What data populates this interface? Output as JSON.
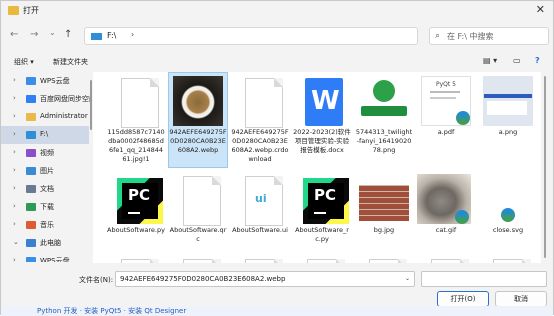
{
  "window": {
    "title": "打开",
    "close_glyph": "✕"
  },
  "nav": {
    "back": "←",
    "forward": "→",
    "up_menu": "⌄",
    "up": "↑",
    "path": "F:\\",
    "path_sep": "›",
    "dropdown": "⌄",
    "refresh": "↻",
    "search_placeholder": "在 F:\\ 中搜索"
  },
  "toolbar": {
    "organize": "组织 ▾",
    "new_folder": "新建文件夹",
    "view": "▤ ▾",
    "pane": "▭",
    "help": "?"
  },
  "sidebar": {
    "items": [
      {
        "label": "WPS云盘",
        "icon": "cloud-icon",
        "color": "#3b8ee8"
      },
      {
        "label": "百度网盘同步空间",
        "icon": "baidu-icon",
        "color": "#2f7ff5"
      },
      {
        "label": "Administrator",
        "icon": "user-folder-icon",
        "color": "#e9b94a"
      },
      {
        "label": "F:\\",
        "icon": "drive-icon",
        "color": "#2f8ed8"
      },
      {
        "label": "视频",
        "icon": "video-icon",
        "color": "#8a4fc9"
      },
      {
        "label": "图片",
        "icon": "pictures-icon",
        "color": "#3a8ad4"
      },
      {
        "label": "文档",
        "icon": "documents-icon",
        "color": "#6a7a90"
      },
      {
        "label": "下载",
        "icon": "download-icon",
        "color": "#2e9a5a"
      },
      {
        "label": "音乐",
        "icon": "music-icon",
        "color": "#e05a32"
      },
      {
        "label": "此电脑",
        "icon": "pc-icon",
        "color": "#3b7fd0"
      },
      {
        "label": "WPS云盘",
        "icon": "cloud-icon",
        "color": "#3b8ee8"
      }
    ],
    "selected_index": 3
  },
  "files": {
    "row1": [
      {
        "name": "115dd8587c7140dba0002f48685d6fe1_qq_21484461.jpg!1",
        "kind": "blank",
        "selected": false
      },
      {
        "name": "942AEFE649275F0D0280CA0B23E608A2.webp",
        "kind": "food",
        "selected": true
      },
      {
        "name": "942AEFE649275F0D0280CA0B23E608A2.webp.crdownload",
        "kind": "blank",
        "selected": false
      },
      {
        "name": "2022-2023(2)软件项目管理实验-实验报告模板.docx",
        "kind": "wps",
        "selected": false
      },
      {
        "name": "5744313_twilight-fanyi_1641902078.png",
        "kind": "techfanyi",
        "selected": false
      },
      {
        "name": "a.pdf",
        "kind": "pdf",
        "selected": false
      },
      {
        "name": "a.png",
        "kind": "apng",
        "selected": false
      }
    ],
    "row2": [
      {
        "name": "AboutSoftware.py",
        "kind": "pycharm",
        "selected": false
      },
      {
        "name": "AboutSoftware.qrc",
        "kind": "blank",
        "selected": false
      },
      {
        "name": "AboutSoftware.ui",
        "kind": "ui",
        "selected": false
      },
      {
        "name": "AboutSoftware_rc.py",
        "kind": "pycharm",
        "selected": false
      },
      {
        "name": "bg.jpg",
        "kind": "brick",
        "selected": false
      },
      {
        "name": "cat.gif",
        "kind": "cat",
        "selected": false
      },
      {
        "name": "close.svg",
        "kind": "edge",
        "selected": false
      }
    ],
    "row3": [
      {
        "name": "",
        "kind": "blank"
      },
      {
        "name": "",
        "kind": "blank"
      },
      {
        "name": "",
        "kind": "blank"
      },
      {
        "name": "",
        "kind": "blank"
      },
      {
        "name": "",
        "kind": "blank"
      },
      {
        "name": "",
        "kind": "blank"
      },
      {
        "name": "",
        "kind": "blank"
      }
    ]
  },
  "bottom": {
    "filename_label": "文件名(N):",
    "filename_value": "942AEFE649275F0D0280CA0B23E608A2.webp",
    "dropdown": "⌄",
    "open_label": "打开(O)",
    "cancel_label": "取消",
    "background_text": "Python 开发  ·  安装 PyQt5  ·  安装 Qt Designer"
  }
}
